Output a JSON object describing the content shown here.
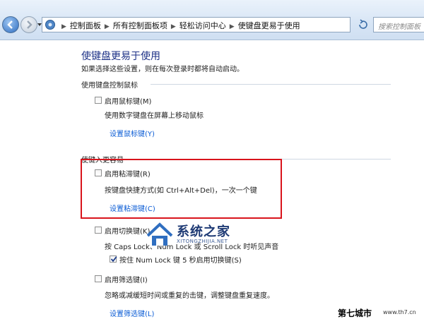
{
  "address_bar": {
    "breadcrumbs": [
      "控制面板",
      "所有控制面板项",
      "轻松访问中心",
      "使键盘更易于使用"
    ],
    "search_placeholder": "搜索控制面板"
  },
  "page": {
    "title": "使键盘更易于使用",
    "subtitle": "如果选择这些设置，则在每次登录时都将自动启动。"
  },
  "sections": {
    "mouse": {
      "heading": "使用键盘控制鼠标",
      "option_label": "启用鼠标键(M)",
      "option_checked": false,
      "description": "使用数字键盘在屏幕上移动鼠标",
      "link": "设置鼠标键(Y)"
    },
    "typing": {
      "heading": "使键入更容易",
      "sticky": {
        "option_label": "启用粘滞键(R)",
        "option_checked": false,
        "description": "按键盘快捷方式(如 Ctrl+Alt+Del)，一次一个键",
        "link": "设置粘滞键(C)"
      },
      "toggle": {
        "option_label": "启用切换键(K)",
        "option_checked": false,
        "description": "按 Caps Lock、Num Lock 或 Scroll Lock 时听见声音",
        "sub_option_label": "按住 Num Lock 键 5 秒启用切换键(S)",
        "sub_option_checked": true
      },
      "filter": {
        "option_label": "启用筛选键(I)",
        "option_checked": false,
        "description": "忽略或减缓短时间或重复的击键，调整键盘重复速度。",
        "link": "设置筛选键(L)"
      }
    }
  },
  "watermarks": {
    "center_title": "系统之家",
    "center_url": "XITONGZHIJIA.NET",
    "corner_title": "第七城市",
    "corner_url": "www.th7.cn"
  },
  "colors": {
    "title": "#1e3287",
    "link": "#0b5cd5",
    "highlight_box": "#d9141c"
  }
}
